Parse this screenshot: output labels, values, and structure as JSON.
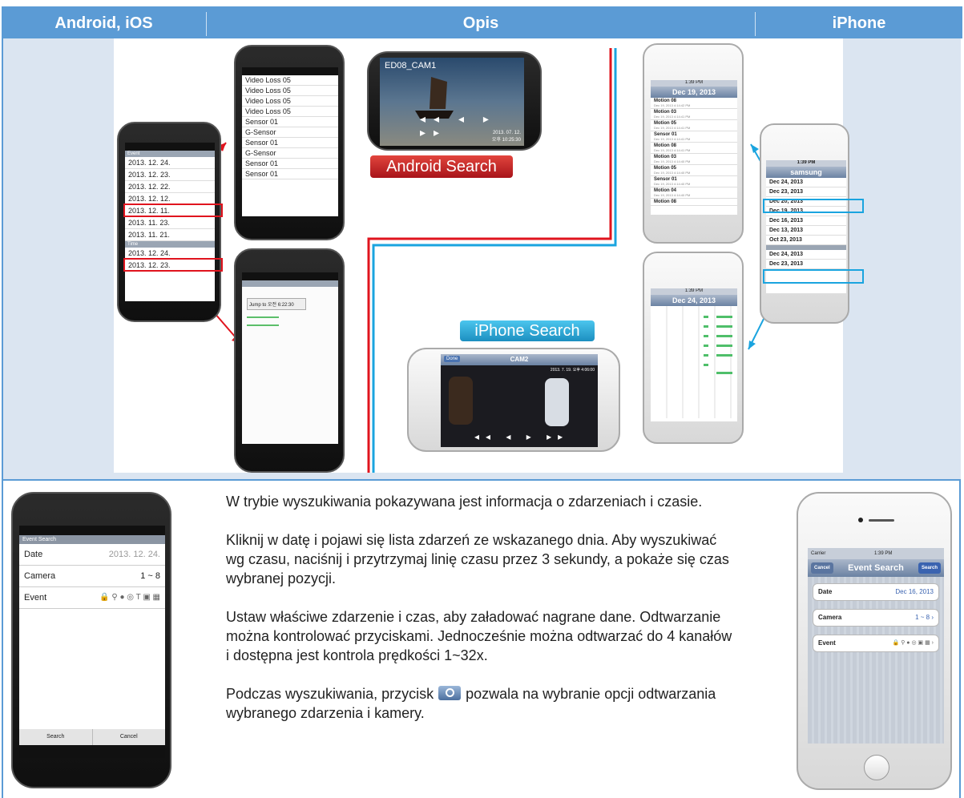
{
  "header": {
    "col_left": "Android, iOS",
    "col_mid": "Opis",
    "col_right": "iPhone"
  },
  "collage": {
    "android_search_label": "Android Search",
    "iphone_search_label": "iPhone Search",
    "player_title": "ED08_CAM1",
    "player_time": "2013. 07. 12. 오후 10:25:30",
    "left_phone": {
      "header": "Event",
      "dates": [
        "2013. 12. 24.",
        "2013. 12. 23.",
        "2013. 12. 22.",
        "2013. 12. 12.",
        "2013. 12. 11.",
        "2013. 11. 23.",
        "2013. 11. 21."
      ],
      "time_header": "Time",
      "time_dates": [
        "2013. 12. 24.",
        "2013. 12. 23."
      ]
    },
    "event_list": [
      "Video Loss 05",
      "Video Loss 05",
      "Video Loss 05",
      "Video Loss 05",
      "Sensor 01",
      "G-Sensor",
      "Sensor 01",
      "G-Sensor",
      "Sensor 01",
      "Sensor 01"
    ],
    "jump_label": "Jump to 오전 6:22:30",
    "ios_list_title": "Dec 19, 2013",
    "ios_events": [
      {
        "name": "Motion 08",
        "time": "Dec 19, 2013 4:14:42 PM"
      },
      {
        "name": "Motion 03",
        "time": "Dec 19, 2013 4:14:41 PM"
      },
      {
        "name": "Motion 05",
        "time": "Dec 19, 2013 4:14:41 PM"
      },
      {
        "name": "Sensor 01",
        "time": "Dec 19, 2013 4:14:41 PM"
      },
      {
        "name": "Motion 08",
        "time": "Dec 19, 2013 4:14:41 PM"
      },
      {
        "name": "Motion 03",
        "time": "Dec 19, 2013 4:14:40 PM"
      },
      {
        "name": "Motion 05",
        "time": "Dec 19, 2013 4:14:40 PM"
      },
      {
        "name": "Sensor 01",
        "time": "Dec 19, 2013 4:14:40 PM"
      },
      {
        "name": "Motion 04",
        "time": "Dec 19, 2013 4:14:40 PM"
      },
      {
        "name": "Motion 08",
        "time": ""
      }
    ],
    "ios_date_title": "samsung",
    "ios_dates": [
      "Dec 24, 2013",
      "Dec 23, 2013",
      "Dec 20, 2013",
      "Dec 19, 2013",
      "Dec 16, 2013",
      "Dec 13, 2013",
      "Oct 23, 2013"
    ],
    "ios_time_dates": [
      "Dec 24, 2013",
      "Dec 23, 2013"
    ],
    "ios_timeline_title": "Dec 24, 2013",
    "ios_clock": "1:39 PM",
    "ios_carrier": "Carrier",
    "ios_player_title": "CAM2",
    "ios_player_time": "2013. 7. 19. 오후 4:06:00",
    "ios_player_done": "Done"
  },
  "left_phone": {
    "title": "Event Search",
    "rows": [
      {
        "label": "Date",
        "value": "2013. 12. 24."
      },
      {
        "label": "Camera",
        "value": "1 ~ 8"
      },
      {
        "label": "Event",
        "value": ""
      }
    ],
    "search_btn": "Search",
    "cancel_btn": "Cancel"
  },
  "description": {
    "p1": "W trybie wyszukiwania pokazywana jest informacja o zdarzeniach i czasie.",
    "p2": "Kliknij w datę i pojawi się lista zdarzeń ze wskazanego dnia. Aby wyszukiwać wg czasu, naciśnij i przytrzymaj linię czasu przez 3 sekundy, a pokaże się czas wybranej pozycji.",
    "p3": "Ustaw właściwe zdarzenie i czas, aby załadować nagrane dane. Odtwarzanie można kontrolować przyciskami. Jednocześnie można odtwarzać do 4 kanałów i dostępna jest kontrola prędkości 1~32x.",
    "p4_before": "Podczas wyszukiwania, przycisk",
    "p4_after": "pozwala na wybranie opcji odtwarzania wybranego zdarzenia i kamery."
  },
  "right_phone": {
    "carrier": "Carrier",
    "clock": "1:39 PM",
    "title": "Event Search",
    "cancel_btn": "Cancel",
    "search_btn": "Search",
    "rows": [
      {
        "label": "Date",
        "value": "Dec 16, 2013"
      },
      {
        "label": "Camera",
        "value": "1 ~ 8"
      },
      {
        "label": "Event",
        "value": ""
      }
    ]
  },
  "colors": {
    "header_bg": "#5b9bd5",
    "row_bg": "#dbe5f1",
    "accent_red": "#e0141e",
    "accent_blue": "#1aa4df"
  }
}
